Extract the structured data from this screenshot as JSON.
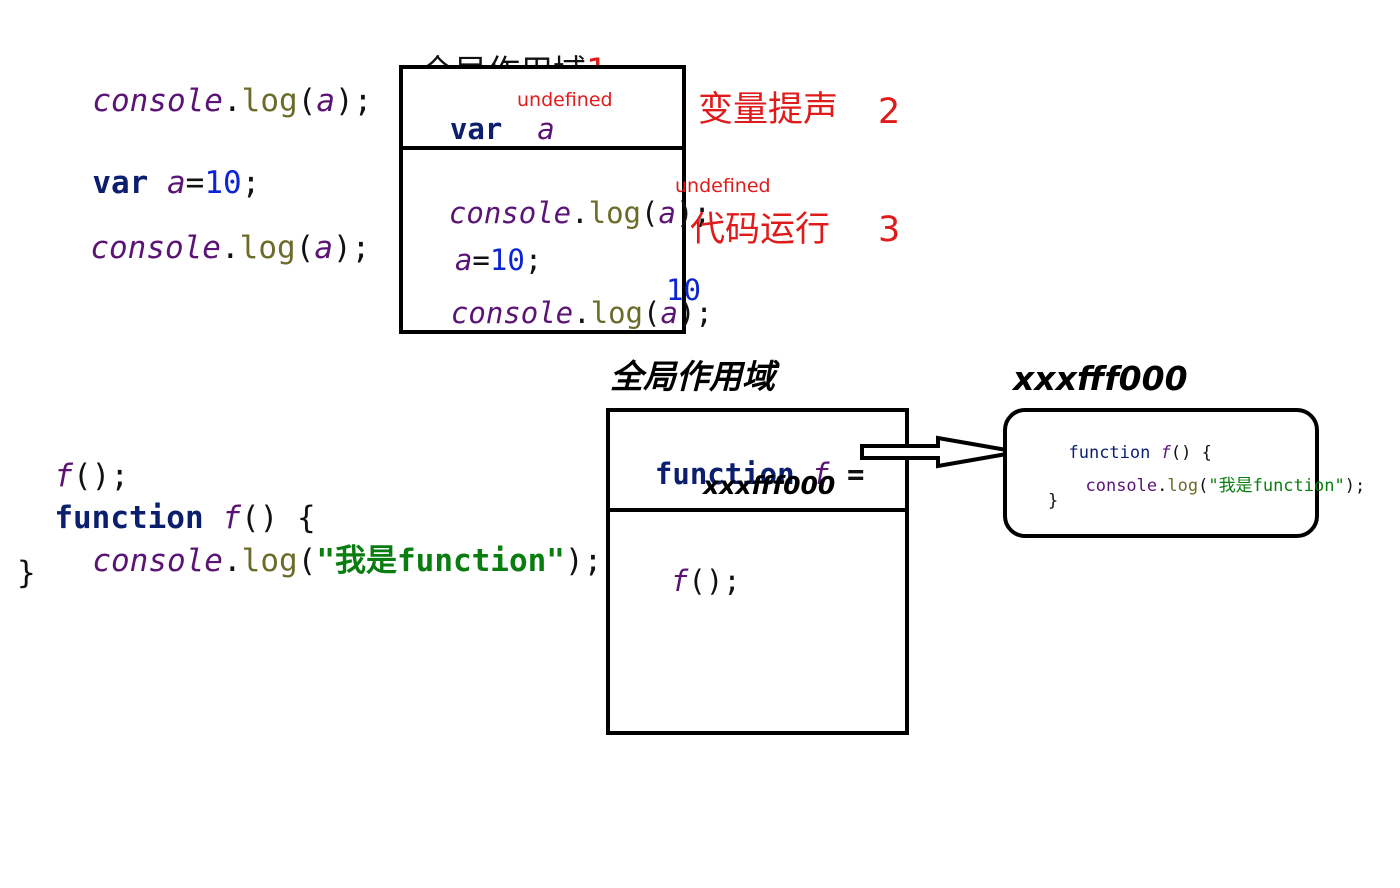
{
  "top": {
    "left_code": {
      "line1": {
        "obj": "console",
        "dot": ".",
        "fn": "log",
        "open": "(",
        "arg": "a",
        "close": ");"
      },
      "line2": {
        "kw": "var",
        "var": "a",
        "eq": "=",
        "num": "10",
        "semi": ";"
      },
      "line3": {
        "obj": "console",
        "dot": ".",
        "fn": "log",
        "open": "(",
        "arg": "a",
        "close": ");"
      }
    },
    "scope_title": "全局作用域",
    "scope_num": "1",
    "box": {
      "hoist": {
        "kw": "var",
        "var": "a",
        "value": "undefined"
      },
      "run_line1": {
        "obj": "console",
        "dot": ".",
        "fn": "log",
        "open": "(",
        "arg": "a",
        "close": ");",
        "result": "undefined"
      },
      "run_line2": {
        "var": "a",
        "eq": "=",
        "num": "10",
        "semi": ";"
      },
      "run_line3": {
        "obj": "console",
        "dot": ".",
        "fn": "log",
        "open": "(",
        "arg": "a",
        "close": ");",
        "result": "10"
      }
    },
    "labels": {
      "hoisting": "变量提声",
      "hoisting_num": "2",
      "running": "代码运行",
      "running_num": "3"
    }
  },
  "bottom": {
    "left_code": {
      "line1": {
        "fn": "f",
        "rest": "();"
      },
      "line2": {
        "kw": "function",
        "name": "f",
        "rest": "() {"
      },
      "line3": {
        "obj": "console",
        "dot": ".",
        "fn": "log",
        "open": "(",
        "str": "\"我是function\"",
        "close": ");"
      },
      "line4": "}"
    },
    "scope_title": "全局作用域",
    "heap_title": "xxxfff000",
    "box": {
      "decl": {
        "kw": "function",
        "name": "f",
        "eq": "="
      },
      "address": "xxxfff000",
      "call": {
        "fn": "f",
        "rest": "();"
      }
    },
    "heap": {
      "line1": {
        "kw": "function",
        "name": "f",
        "rest": "() {"
      },
      "line2": {
        "obj": "console",
        "dot": ".",
        "fn": "log",
        "open": "(",
        "str": "\"我是function\"",
        "close": ");"
      },
      "line3": "}"
    }
  },
  "colors": {
    "keyword": "#0b1f6e",
    "object": "#5b1475",
    "method": "#6b6b2a",
    "number": "#0a24d6",
    "string": "#0a7d10",
    "annotation": "#e01b1b"
  }
}
